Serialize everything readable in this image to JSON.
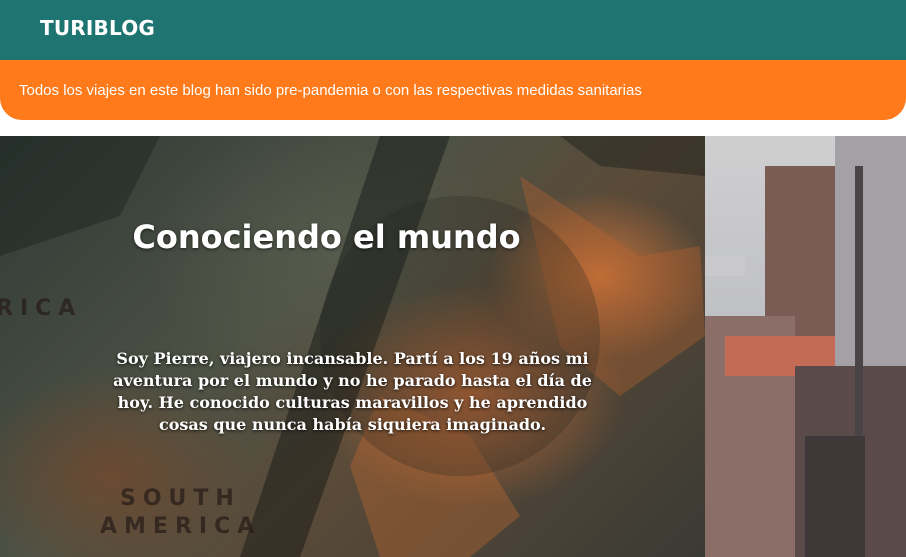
{
  "header": {
    "brand": "TURIBLOG",
    "background_color": "#1e7470"
  },
  "notice": {
    "text": "Todos los viajes en este blog han sido pre-pandemia o con las respectivas medidas sanitarias",
    "background_color": "#ff7a1a"
  },
  "hero": {
    "title": "Conociendo el mundo",
    "text": "Soy Pierre, viajero incansable. Partí a los 19 años mi aventura por el mundo y no he parado hasta el día de hoy. He conocido culturas maravillos y he aprendido cosas que nunca había siquiera imaginado.",
    "map_labels": [
      "RICA",
      "SOUTH",
      "AMERICA"
    ]
  },
  "side_image": {
    "description_icon": "city-photo"
  }
}
